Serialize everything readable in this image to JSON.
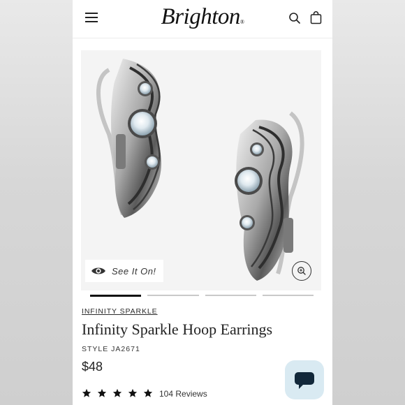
{
  "brand": {
    "logo_text": "Brighton",
    "logo_mark": "®"
  },
  "header": {
    "menu_icon": "hamburger-menu-icon",
    "search_icon": "search-icon",
    "bag_icon": "shopping-bag-icon"
  },
  "gallery": {
    "try_on_label": "See It On!",
    "try_on_icon": "eye-icon",
    "zoom_icon": "zoom-in-icon",
    "slide_count": 4,
    "active_slide": 1
  },
  "product": {
    "collection": "INFINITY SPARKLE",
    "name": "Infinity Sparkle Hoop Earrings",
    "style": "STYLE JA2671",
    "price": "$48",
    "rating": 5,
    "rating_max": 5,
    "reviews": "104 Reviews"
  },
  "chat": {
    "icon": "chat-bubble-icon"
  },
  "colors": {
    "text": "#1e1e1e",
    "chat_bg": "#d9eaf2",
    "chat_icon": "#12283a",
    "image_bg": "#f4f4f4"
  }
}
